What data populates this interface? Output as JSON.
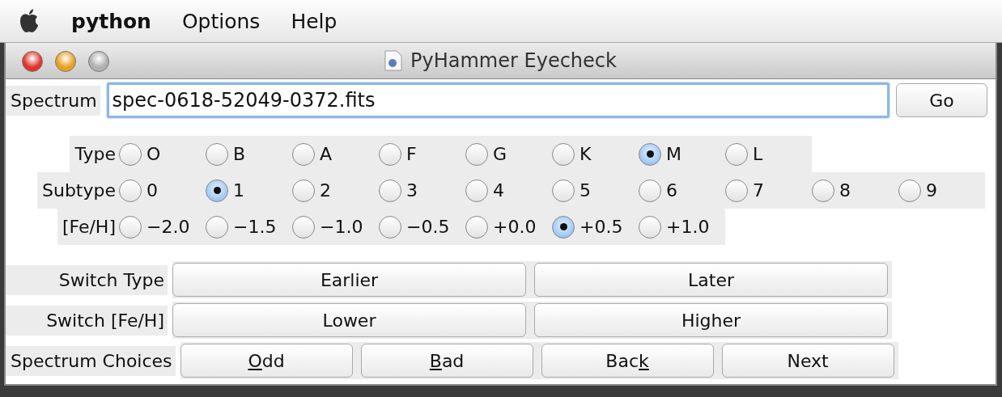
{
  "menu_bar": [
    {
      "label": "python",
      "kind": "app"
    },
    {
      "label": "Options",
      "kind": "menu"
    },
    {
      "label": "Help",
      "kind": "menu"
    }
  ],
  "window": {
    "title": "PyHammer Eyecheck"
  },
  "spectrum": {
    "label": "Spectrum",
    "value": "spec-0618-52049-0372.fits",
    "button": "Go"
  },
  "radio_groups": [
    {
      "label": "Type",
      "options": [
        {
          "label": "O",
          "selected": false
        },
        {
          "label": "B",
          "selected": false
        },
        {
          "label": "A",
          "selected": false
        },
        {
          "label": "F",
          "selected": false
        },
        {
          "label": "G",
          "selected": false
        },
        {
          "label": "K",
          "selected": false
        },
        {
          "label": "M",
          "selected": true
        },
        {
          "label": "L",
          "selected": false
        }
      ]
    },
    {
      "label": "Subtype",
      "options": [
        {
          "label": "0",
          "selected": false
        },
        {
          "label": "1",
          "selected": true
        },
        {
          "label": "2",
          "selected": false
        },
        {
          "label": "3",
          "selected": false
        },
        {
          "label": "4",
          "selected": false
        },
        {
          "label": "5",
          "selected": false
        },
        {
          "label": "6",
          "selected": false
        },
        {
          "label": "7",
          "selected": false
        },
        {
          "label": "8",
          "selected": false
        },
        {
          "label": "9",
          "selected": false
        }
      ]
    },
    {
      "label": "[Fe/H]",
      "options": [
        {
          "label": "−2.0",
          "selected": false
        },
        {
          "label": "−1.5",
          "selected": false
        },
        {
          "label": "−1.0",
          "selected": false
        },
        {
          "label": "−0.5",
          "selected": false
        },
        {
          "label": "+0.0",
          "selected": false
        },
        {
          "label": "+0.5",
          "selected": true
        },
        {
          "label": "+1.0",
          "selected": false
        }
      ]
    }
  ],
  "button_rows": [
    {
      "label": "Switch Type",
      "buttons": [
        {
          "kind": "wide",
          "label": "Earlier"
        },
        {
          "kind": "wide",
          "label": "Later"
        }
      ]
    },
    {
      "label": "Switch [Fe/H]",
      "buttons": [
        {
          "kind": "wide",
          "label": "Lower"
        },
        {
          "kind": "wide",
          "label": "Higher"
        }
      ]
    },
    {
      "label": "Spectrum Choices",
      "buttons": [
        {
          "kind": "narrow",
          "key": "O",
          "after": "dd"
        },
        {
          "kind": "narrow",
          "key": "B",
          "after": "ad"
        },
        {
          "kind": "narrow",
          "before": "Bac",
          "key": "k"
        },
        {
          "kind": "narrow",
          "label": "Next"
        }
      ]
    }
  ]
}
